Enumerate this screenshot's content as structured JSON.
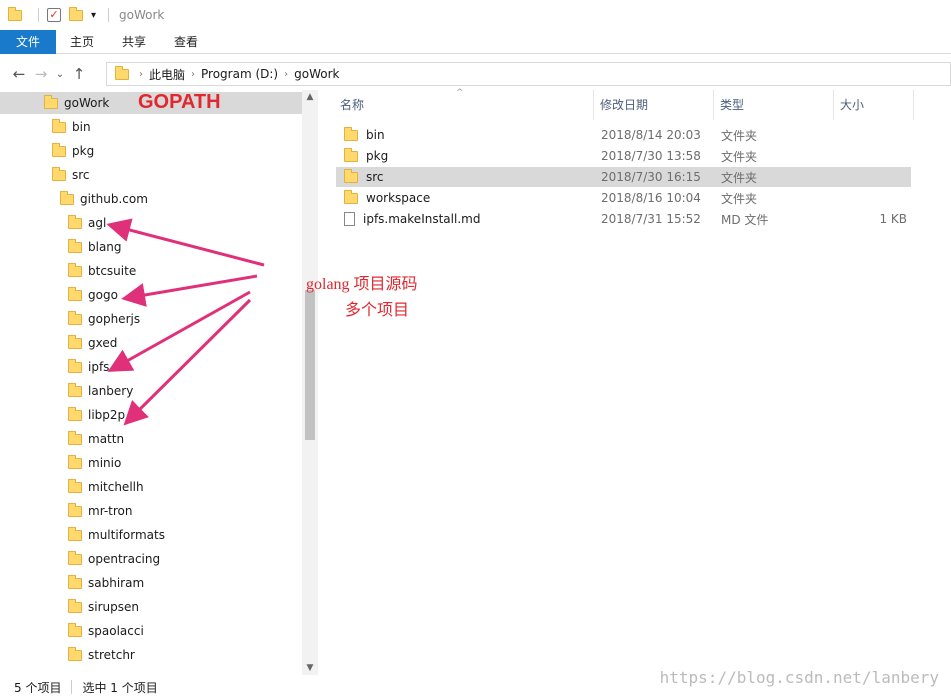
{
  "window": {
    "title": "goWork"
  },
  "ribbon": {
    "tabs": [
      "文件",
      "主页",
      "共享",
      "查看"
    ]
  },
  "address": {
    "crumbs": [
      "此电脑",
      "Program (D:)",
      "goWork"
    ]
  },
  "tree": {
    "root": "goWork",
    "level1": [
      "bin",
      "pkg",
      "src"
    ],
    "level2": [
      "github.com"
    ],
    "level3": [
      "agl",
      "blang",
      "btcsuite",
      "gogo",
      "gopherjs",
      "gxed",
      "ipfs",
      "lanbery",
      "libp2p",
      "mattn",
      "minio",
      "mitchellh",
      "mr-tron",
      "multiformats",
      "opentracing",
      "sabhiram",
      "sirupsen",
      "spaolacci",
      "stretchr"
    ]
  },
  "columns": {
    "name": "名称",
    "date": "修改日期",
    "type": "类型",
    "size": "大小"
  },
  "files": [
    {
      "name": "bin",
      "date": "2018/8/14 20:03",
      "type": "文件夹",
      "size": "",
      "icon": "folder-icon"
    },
    {
      "name": "pkg",
      "date": "2018/7/30 13:58",
      "type": "文件夹",
      "size": "",
      "icon": "folder-icon"
    },
    {
      "name": "src",
      "date": "2018/7/30 16:15",
      "type": "文件夹",
      "size": "",
      "icon": "folder-icon",
      "selected": true
    },
    {
      "name": "workspace",
      "date": "2018/8/16 10:04",
      "type": "文件夹",
      "size": "",
      "icon": "folder-icon"
    },
    {
      "name": "ipfs.makeInstall.md",
      "date": "2018/7/31 15:52",
      "type": "MD 文件",
      "size": "1 KB",
      "icon": "file-icon"
    }
  ],
  "annotations": {
    "gopath": "GOPATH",
    "line1": "golang 项目源码",
    "line2": "多个项目",
    "color": "#e0282f"
  },
  "status": {
    "count": "5 个项目",
    "selected": "选中 1 个项目"
  },
  "watermark": "https://blog.csdn.net/lanbery"
}
